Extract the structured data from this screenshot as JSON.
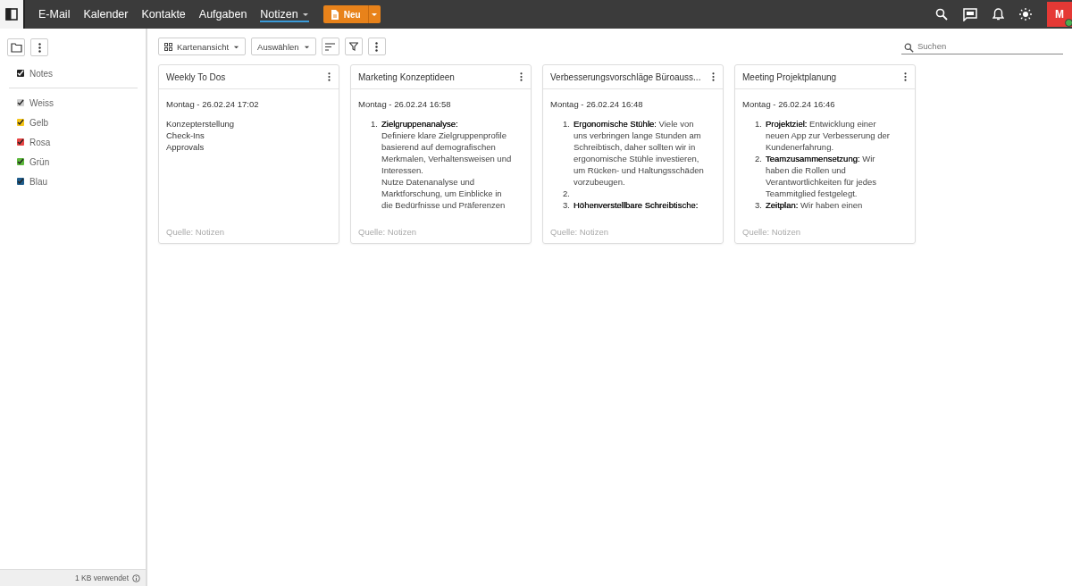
{
  "topbar": {
    "nav": [
      {
        "label": "E-Mail",
        "selected": false
      },
      {
        "label": "Kalender",
        "selected": false
      },
      {
        "label": "Kontakte",
        "selected": false
      },
      {
        "label": "Aufgaben",
        "selected": false
      },
      {
        "label": "Notizen",
        "selected": true
      }
    ],
    "new_button": "Neu",
    "avatar": "M"
  },
  "sidebar": {
    "books": [
      {
        "label": "Notes",
        "checked": true
      }
    ],
    "categories": [
      {
        "label": "Weiss",
        "checked": true,
        "color": "#cfcfcf"
      },
      {
        "label": "Gelb",
        "checked": true,
        "color": "#f5c518"
      },
      {
        "label": "Rosa",
        "checked": true,
        "color": "#e84545"
      },
      {
        "label": "Grün",
        "checked": true,
        "color": "#5cb83c"
      },
      {
        "label": "Blau",
        "checked": true,
        "color": "#1f5d8c"
      }
    ],
    "footer": "1 KB verwendet"
  },
  "toolbar": {
    "view": "Kartenansicht",
    "select": "Auswählen",
    "search": {
      "placeholder": "Suchen"
    }
  },
  "cards": [
    {
      "title": "Weekly To Dos",
      "date": "Montag - 26.02.24 17:02",
      "lines": [
        "Konzepterstellung",
        "Check-Ins",
        "Approvals"
      ],
      "source": "Quelle: Notizen"
    },
    {
      "title": "Marketing Konzeptideen",
      "date": "Montag - 26.02.24 16:58",
      "items": [
        {
          "number": "1.",
          "lines": [
            "**Zielgruppenanalyse:**",
            "Definiere klare Zielgruppenprofile",
            "basierend auf demografischen",
            "Merkmalen, Verhaltensweisen und",
            "Interessen.",
            "Nutze Datenanalyse und",
            "Marktforschung, um Einblicke in",
            "die Bedürfnisse und Präferenzen"
          ]
        }
      ],
      "source": "Quelle: Notizen"
    },
    {
      "title": "Verbesserungsvorschläge Büroauss...",
      "date": "Montag - 26.02.24 16:48",
      "items": [
        {
          "number": "1.",
          "lines": [
            "**Ergonomische Stühle:** Viele von",
            "uns verbringen lange Stunden am",
            "Schreibtisch, daher sollten wir in",
            "ergonomische Stühle investieren,",
            "um Rücken- und Haltungsschäden",
            "vorzubeugen."
          ]
        },
        {
          "number": "2."
        },
        {
          "number": "3.",
          "lines": [
            "**Höhenverstellbare Schreibtische:**"
          ]
        }
      ],
      "source": "Quelle: Notizen"
    },
    {
      "title": "Meeting Projektplanung",
      "date": "Montag - 26.02.24 16:46",
      "items": [
        {
          "number": "1.",
          "lines": [
            "**Projektziel:** Entwicklung einer",
            "neuen App zur Verbesserung der",
            "Kundenerfahrung."
          ]
        },
        {
          "number": "2.",
          "lines": [
            "**Teamzusammensetzung:** Wir",
            "haben die Rollen und",
            "Verantwortlichkeiten für jedes",
            "Teammitglied festgelegt."
          ]
        },
        {
          "number": "3.",
          "lines": [
            "**Zeitplan:** Wir haben einen"
          ]
        }
      ],
      "source": "Quelle: Notizen"
    }
  ]
}
